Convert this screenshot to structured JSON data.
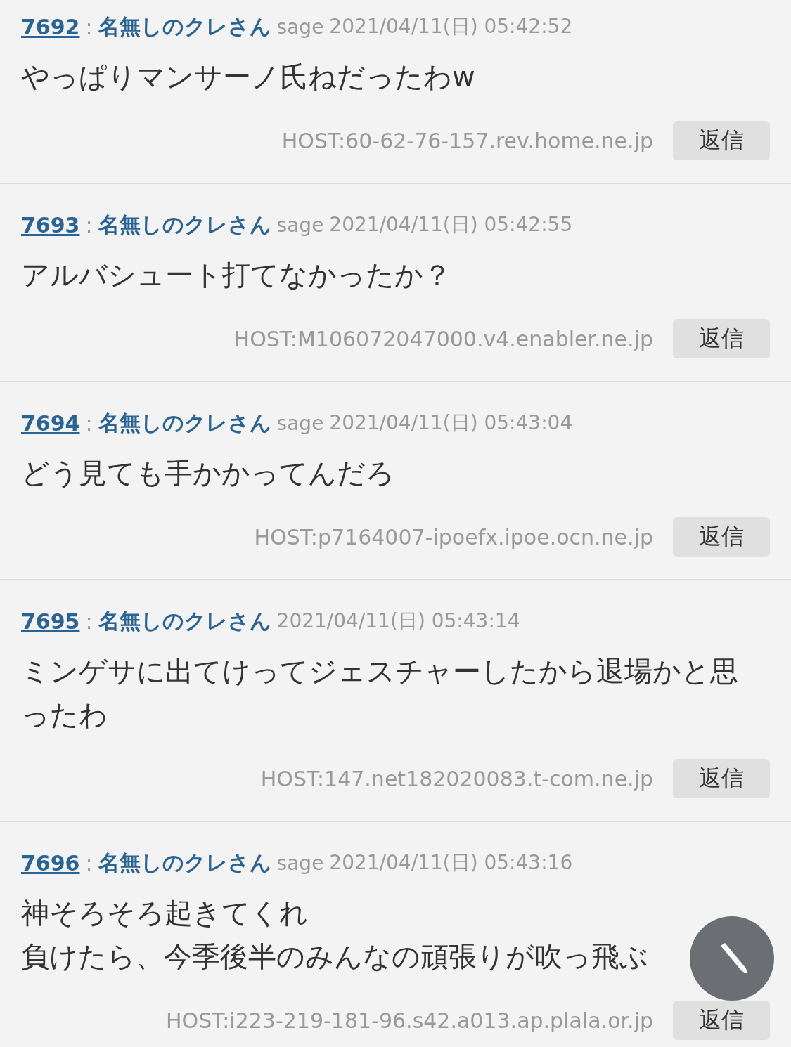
{
  "posts": [
    {
      "number": "7692",
      "separator": ":",
      "name": "名無しのクレさん",
      "mail": "sage",
      "date": "2021/04/11(日) 05:42:52",
      "body": [
        "やっぱりマンサーノ氏ねだったわw"
      ],
      "host": "HOST:60-62-76-157.rev.home.ne.jp",
      "reply": "返信"
    },
    {
      "number": "7693",
      "separator": ":",
      "name": "名無しのクレさん",
      "mail": "sage",
      "date": "2021/04/11(日) 05:42:55",
      "body": [
        "アルバシュート打てなかったか？"
      ],
      "host": "HOST:M106072047000.v4.enabler.ne.jp",
      "reply": "返信"
    },
    {
      "number": "7694",
      "separator": ":",
      "name": "名無しのクレさん",
      "mail": "sage",
      "date": "2021/04/11(日) 05:43:04",
      "body": [
        "どう見ても手かかってんだろ"
      ],
      "host": "HOST:p7164007-ipoefx.ipoe.ocn.ne.jp",
      "reply": "返信"
    },
    {
      "number": "7695",
      "separator": ":",
      "name": "名無しのクレさん",
      "date": "2021/04/11(日) 05:43:14",
      "body": [
        "ミンゲサに出てけってジェスチャーしたから退場かと思ったわ"
      ],
      "host": "HOST:147.net182020083.t-com.ne.jp",
      "reply": "返信"
    },
    {
      "number": "7696",
      "separator": ":",
      "name": "名無しのクレさん",
      "mail": "sage",
      "date": "2021/04/11(日) 05:43:16",
      "body": [
        "神そろそろ起きてくれ",
        "負けたら、今季後半のみんなの頑張りが吹っ飛ぶ"
      ],
      "host": "HOST:i223-219-181-96.s42.a013.ap.plala.or.jp",
      "reply": "返信"
    }
  ]
}
